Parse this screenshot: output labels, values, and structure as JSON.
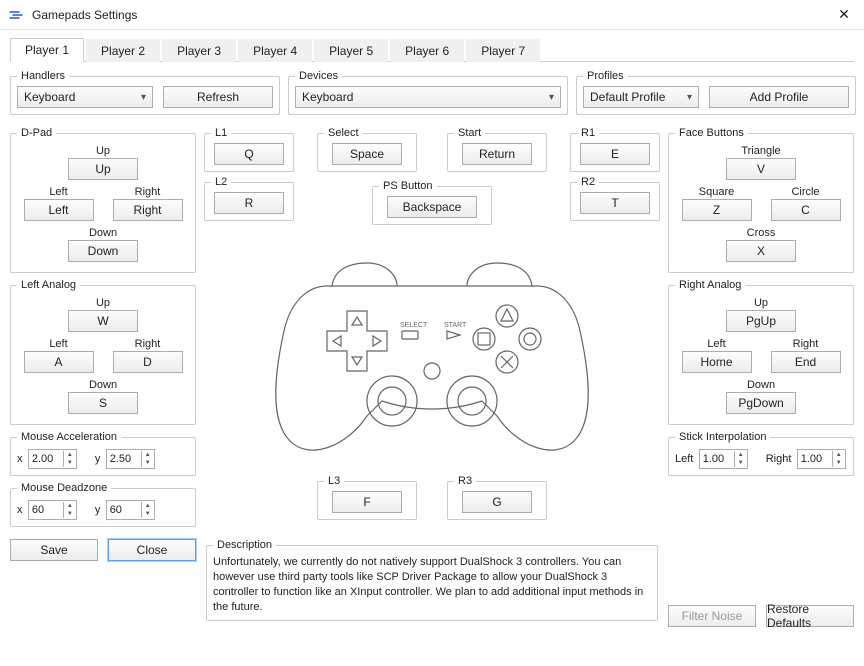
{
  "window": {
    "title": "Gamepads Settings"
  },
  "tabs": [
    "Player 1",
    "Player 2",
    "Player 3",
    "Player 4",
    "Player 5",
    "Player 6",
    "Player 7"
  ],
  "active_tab": 0,
  "handlers": {
    "legend": "Handlers",
    "value": "Keyboard",
    "refresh": "Refresh"
  },
  "devices": {
    "legend": "Devices",
    "value": "Keyboard"
  },
  "profiles": {
    "legend": "Profiles",
    "value": "Default Profile",
    "add": "Add Profile"
  },
  "dpad": {
    "legend": "D-Pad",
    "up_label": "Up",
    "up": "Up",
    "left_label": "Left",
    "left": "Left",
    "right_label": "Right",
    "right": "Right",
    "down_label": "Down",
    "down": "Down"
  },
  "left_analog": {
    "legend": "Left Analog",
    "up_label": "Up",
    "up": "W",
    "left_label": "Left",
    "left": "A",
    "right_label": "Right",
    "right": "D",
    "down_label": "Down",
    "down": "S"
  },
  "l1": {
    "legend": "L1",
    "value": "Q"
  },
  "l2": {
    "legend": "L2",
    "value": "R"
  },
  "r1": {
    "legend": "R1",
    "value": "E"
  },
  "r2": {
    "legend": "R2",
    "value": "T"
  },
  "select_btn": {
    "legend": "Select",
    "value": "Space"
  },
  "start_btn": {
    "legend": "Start",
    "value": "Return"
  },
  "ps_btn": {
    "legend": "PS Button",
    "value": "Backspace"
  },
  "l3": {
    "legend": "L3",
    "value": "F"
  },
  "r3": {
    "legend": "R3",
    "value": "G"
  },
  "face": {
    "legend": "Face Buttons",
    "tri_label": "Triangle",
    "tri": "V",
    "sq_label": "Square",
    "sq": "Z",
    "ci_label": "Circle",
    "ci": "C",
    "cr_label": "Cross",
    "cr": "X"
  },
  "right_analog": {
    "legend": "Right Analog",
    "up_label": "Up",
    "up": "PgUp",
    "left_label": "Left",
    "left": "Home",
    "right_label": "Right",
    "right": "End",
    "down_label": "Down",
    "down": "PgDown"
  },
  "mouse_accel": {
    "legend": "Mouse Acceleration",
    "x_label": "x",
    "x": "2.00",
    "y_label": "y",
    "y": "2.50"
  },
  "mouse_dead": {
    "legend": "Mouse Deadzone",
    "x_label": "x",
    "x": "60",
    "y_label": "y",
    "y": "60"
  },
  "stick_interp": {
    "legend": "Stick Interpolation",
    "left_label": "Left",
    "left": "1.00",
    "right_label": "Right",
    "right": "1.00"
  },
  "description": {
    "legend": "Description",
    "text": "Unfortunately, we currently do not natively support DualShock 3 controllers. You can however use third party tools like SCP Driver Package to allow your DualShock 3 controller to function like an XInput controller. We plan to add additional input methods in the future."
  },
  "buttons": {
    "save": "Save",
    "close": "Close",
    "filter_noise": "Filter Noise",
    "restore_defaults": "Restore Defaults"
  }
}
